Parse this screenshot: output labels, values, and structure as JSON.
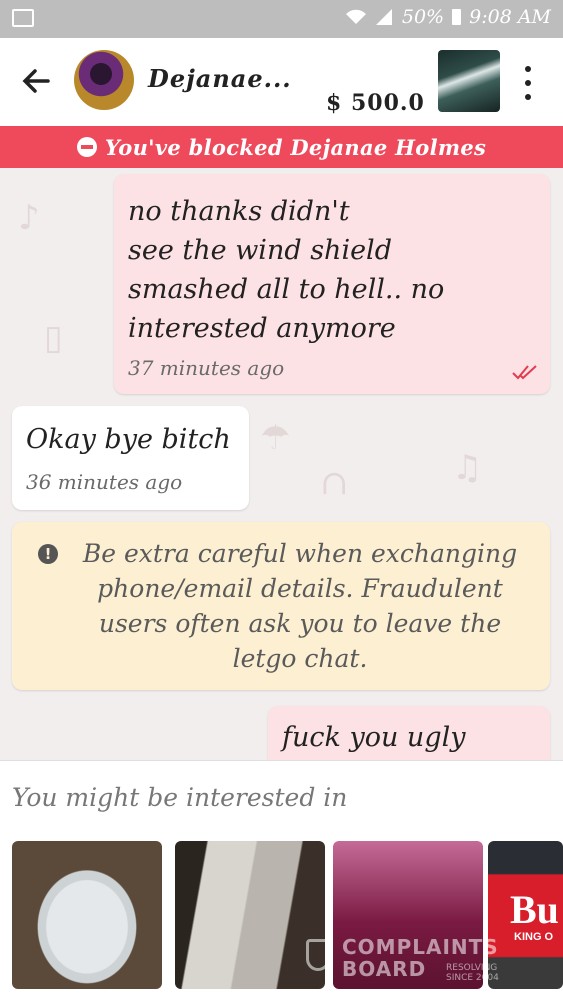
{
  "status_bar": {
    "battery": "50%",
    "time": "9:08 AM"
  },
  "header": {
    "name": "Dejanae...",
    "price": "$ 500.0"
  },
  "blocked_banner": {
    "text": "You've blocked Dejanae Holmes"
  },
  "messages": [
    {
      "direction": "outgoing",
      "text": "no thanks didn't\nsee the wind shield\nsmashed all to hell.. no\ninterested anymore",
      "time": "37 minutes ago",
      "status": "read"
    },
    {
      "direction": "incoming",
      "text": "Okay bye bitch",
      "time": "36 minutes ago"
    },
    {
      "direction": "outgoing",
      "text": "fuck you ugly"
    }
  ],
  "safety_notice": {
    "text": "Be extra careful when exchanging phone/email details. Fraudulent users often ask you to leave the letgo chat."
  },
  "suggestions": {
    "title": "You might be interested in"
  },
  "watermark": {
    "line1": "COMPLAINTS",
    "line2": "BOARD",
    "tagline": "RESOLVING SINCE 2004"
  },
  "ad_text": {
    "logo": "Bu",
    "sub": "KING O"
  },
  "colors": {
    "banner": "#ee4a5c",
    "outgoing_bubble": "#fde2e5",
    "incoming_bubble": "#ffffff",
    "notice": "#fcefd2"
  }
}
